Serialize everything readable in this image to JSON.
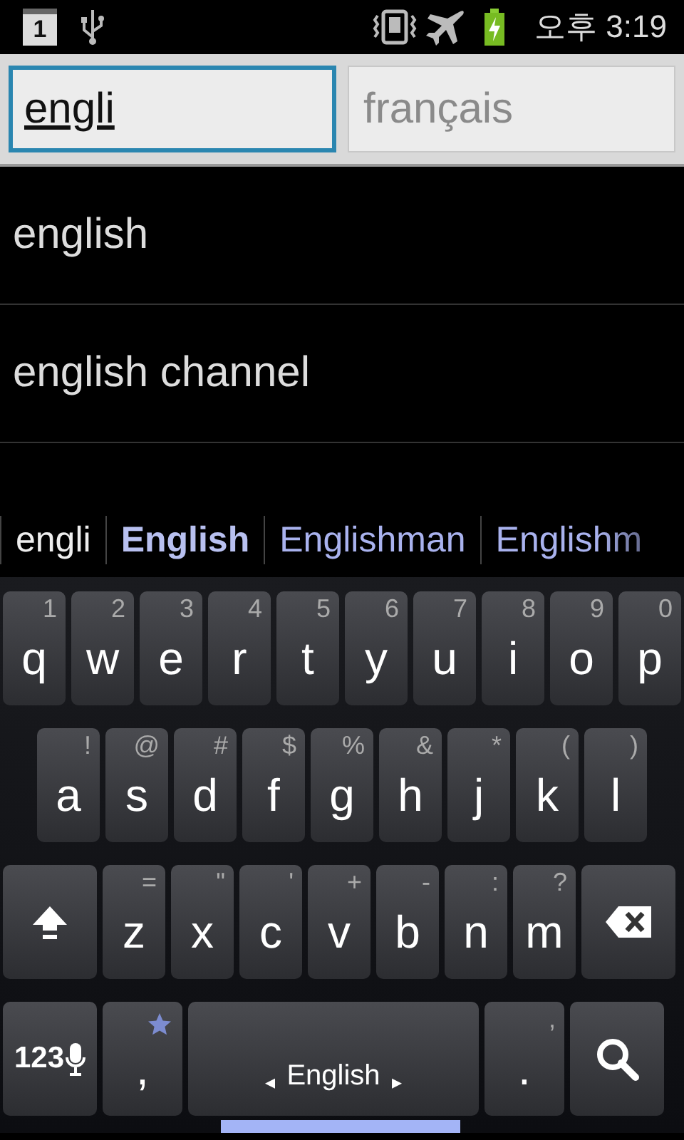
{
  "status_bar": {
    "notification_count": "1",
    "period": "오후",
    "time": "3:19"
  },
  "search": {
    "source": {
      "value": "engli",
      "focused": true
    },
    "target": {
      "placeholder": "français",
      "focused": false
    }
  },
  "results": [
    "english",
    "english channel"
  ],
  "suggestions": [
    {
      "text": "engli",
      "kind": "typed"
    },
    {
      "text": "English",
      "kind": "best"
    },
    {
      "text": "Englishman",
      "kind": "candidate"
    },
    {
      "text": "Englishm",
      "kind": "candidate"
    }
  ],
  "keyboard": {
    "rows": [
      {
        "keys": [
          {
            "kind": "char",
            "label": "q",
            "hint": "1"
          },
          {
            "kind": "char",
            "label": "w",
            "hint": "2"
          },
          {
            "kind": "char",
            "label": "e",
            "hint": "3"
          },
          {
            "kind": "char",
            "label": "r",
            "hint": "4"
          },
          {
            "kind": "char",
            "label": "t",
            "hint": "5"
          },
          {
            "kind": "char",
            "label": "y",
            "hint": "6"
          },
          {
            "kind": "char",
            "label": "u",
            "hint": "7"
          },
          {
            "kind": "char",
            "label": "i",
            "hint": "8"
          },
          {
            "kind": "char",
            "label": "o",
            "hint": "9"
          },
          {
            "kind": "char",
            "label": "p",
            "hint": "0"
          }
        ]
      },
      {
        "keys": [
          {
            "kind": "char",
            "label": "a",
            "hint": "!"
          },
          {
            "kind": "char",
            "label": "s",
            "hint": "@"
          },
          {
            "kind": "char",
            "label": "d",
            "hint": "#"
          },
          {
            "kind": "char",
            "label": "f",
            "hint": "$"
          },
          {
            "kind": "char",
            "label": "g",
            "hint": "%"
          },
          {
            "kind": "char",
            "label": "h",
            "hint": "&"
          },
          {
            "kind": "char",
            "label": "j",
            "hint": "*"
          },
          {
            "kind": "char",
            "label": "k",
            "hint": "("
          },
          {
            "kind": "char",
            "label": "l",
            "hint": ")"
          }
        ]
      },
      {
        "keys": [
          {
            "kind": "shift"
          },
          {
            "kind": "char",
            "label": "z",
            "hint": "="
          },
          {
            "kind": "char",
            "label": "x",
            "hint": "\""
          },
          {
            "kind": "char",
            "label": "c",
            "hint": "'"
          },
          {
            "kind": "char",
            "label": "v",
            "hint": "+"
          },
          {
            "kind": "char",
            "label": "b",
            "hint": "-"
          },
          {
            "kind": "char",
            "label": "n",
            "hint": ":"
          },
          {
            "kind": "char",
            "label": "m",
            "hint": "?"
          },
          {
            "kind": "delete"
          }
        ]
      },
      {
        "keys": [
          {
            "kind": "symbols",
            "label": "123"
          },
          {
            "kind": "star",
            "label": ","
          },
          {
            "kind": "space",
            "label": "English",
            "prev": "◂",
            "next": "▸"
          },
          {
            "kind": "char",
            "label": ".",
            "hint": ","
          },
          {
            "kind": "search"
          }
        ]
      }
    ]
  }
}
